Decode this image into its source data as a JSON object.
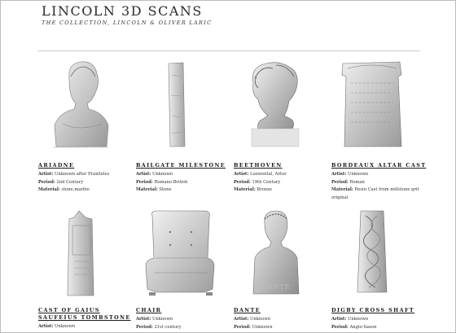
{
  "site": {
    "title": "LINCOLN 3D SCANS",
    "subtitle": "THE COLLECTION, LINCOLN & OLIVER LARIC"
  },
  "labels": {
    "artist": "Artist:",
    "period": "Period:",
    "material": "Material:"
  },
  "items": [
    {
      "name": "ARIADNE",
      "artist": "Unknown after Praxiteles",
      "period": "2nd Century",
      "material": "stone,marble"
    },
    {
      "name": "BAILGATE MILESTONE",
      "artist": "Unknown",
      "period": "Romano-British",
      "material": "Stone"
    },
    {
      "name": "BEETHOVEN",
      "artist": "Loewental, Artur",
      "period": "19th Century",
      "material": "Bronze"
    },
    {
      "name": "BORDEAUX ALTAR CAST",
      "artist": "Unknown",
      "period": "Roman",
      "material": "Resin Cast from millstone grit",
      "material_cont": "original"
    },
    {
      "name": "CAST OF GAIUS",
      "name2": "SAUFEIUS TOMBSTONE",
      "artist": "Unknown"
    },
    {
      "name": "CHAIR",
      "artist": "Unknown",
      "period": "21st century"
    },
    {
      "name": "DANTE",
      "artist": "Unknown",
      "period": "Unknown",
      "plinth_text": "DANTE"
    },
    {
      "name": "DIGBY CROSS SHAFT",
      "artist": "Unknown",
      "period": "Anglo-Saxon"
    }
  ]
}
